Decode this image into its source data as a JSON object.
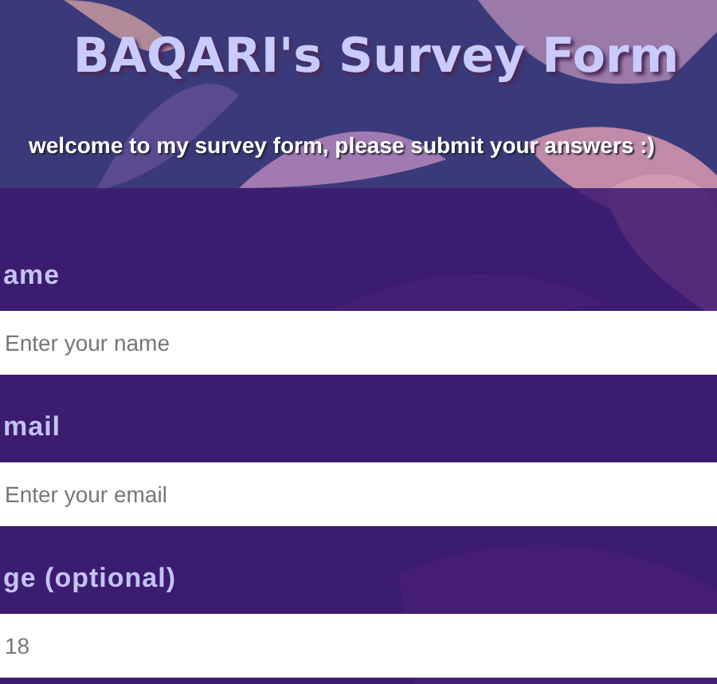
{
  "header": {
    "title": "BAQARI's Survey Form",
    "description": "welcome to my survey form, please submit your answers :)"
  },
  "fields": [
    {
      "label": "ame",
      "placeholder": "Enter your name"
    },
    {
      "label": "mail",
      "placeholder": "Enter your email"
    },
    {
      "label": "ge (optional)",
      "placeholder": "18"
    }
  ]
}
